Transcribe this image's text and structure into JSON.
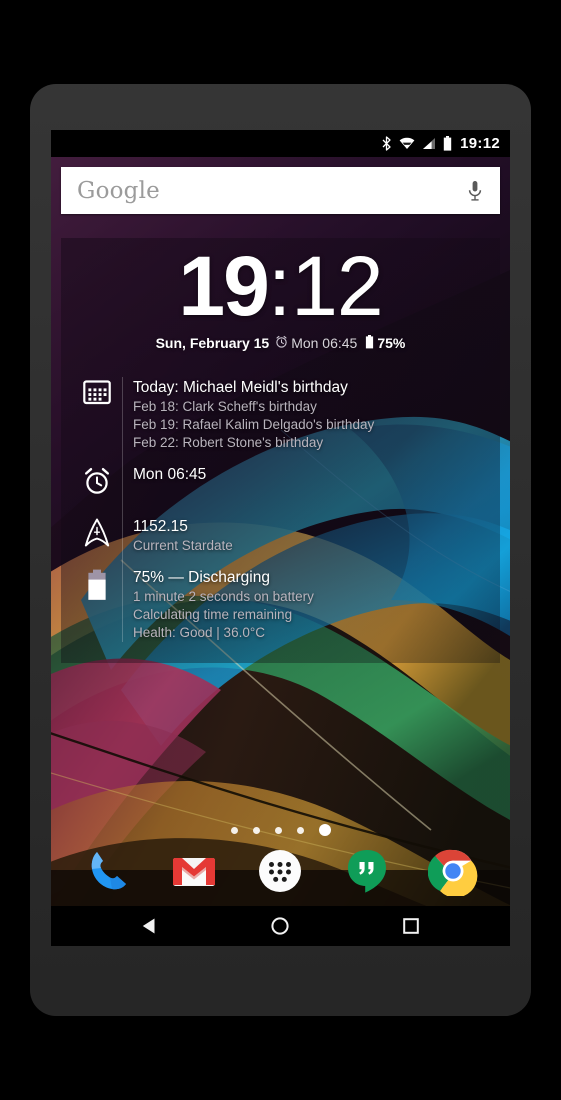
{
  "device": {
    "name": "android-phone"
  },
  "status_bar": {
    "time": "19:12",
    "icons": [
      "bluetooth-icon",
      "wifi-icon",
      "cellular-signal-icon",
      "battery-icon"
    ]
  },
  "search": {
    "logo_text": "Google",
    "placeholder": "Google",
    "mic_icon": "microphone-icon"
  },
  "clock_widget": {
    "hours": "19",
    "separator": ":",
    "minutes": "12",
    "date": "Sun, February 15",
    "alarm_icon": "alarm-clock-icon",
    "alarm_time": "Mon 06:45",
    "battery_icon": "battery-icon",
    "battery_percent": "75%"
  },
  "info_rows": {
    "calendar": {
      "icon": "calendar-icon",
      "title": "Today: Michael Meidl's birthday",
      "events": [
        "Feb 18: Clark Scheff's birthday",
        "Feb 19: Rafael Kalim Delgado's birthday",
        "Feb 22: Robert Stone's birthday"
      ]
    },
    "alarm": {
      "icon": "alarm-clock-icon",
      "title": "Mon 06:45"
    },
    "stardate": {
      "icon": "starfleet-delta-icon",
      "title": "1152.15",
      "subtitle": "Current Stardate"
    },
    "battery": {
      "icon": "battery-icon",
      "title": "75% — Discharging",
      "lines": [
        "1 minute 2 seconds on battery",
        "Calculating time remaining",
        "Health: Good | 36.0°C"
      ]
    }
  },
  "page_indicator": {
    "count": 5,
    "active_index": 4
  },
  "dock": {
    "apps": [
      {
        "name": "phone-app",
        "label": "Phone"
      },
      {
        "name": "gmail-app",
        "label": "Gmail"
      },
      {
        "name": "app-drawer",
        "label": "Apps"
      },
      {
        "name": "hangouts-app",
        "label": "Hangouts"
      },
      {
        "name": "chrome-app",
        "label": "Chrome"
      }
    ]
  },
  "nav_bar": {
    "buttons": [
      {
        "name": "back-button",
        "label": "Back"
      },
      {
        "name": "home-button",
        "label": "Home"
      },
      {
        "name": "recents-button",
        "label": "Recents"
      }
    ]
  },
  "colors": {
    "bezel": "#2e2e2e",
    "status_bar": "#000000",
    "search_bg": "#ffffff",
    "widget_overlay": "#180a1a",
    "text_primary": "#ffffff",
    "text_secondary": "#b9b4bd",
    "phone_blue": "#2196f3",
    "gmail_red": "#e53935",
    "hangouts_green": "#0f9d58",
    "chrome_blue": "#4285f4"
  }
}
